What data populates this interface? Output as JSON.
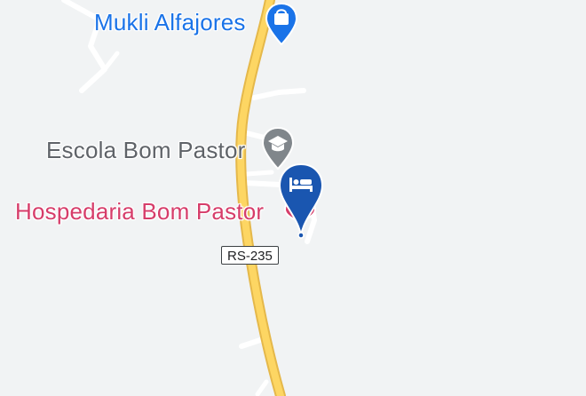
{
  "map": {
    "colors": {
      "background": "#f1f3f4",
      "highway_fill": "#fdd663",
      "highway_casing": "#e5b84a",
      "minor_road": "#ffffff",
      "shop_accent": "#1a73e8",
      "school_accent": "#80868b",
      "hotel_accent": "#d63d6a",
      "selected_pin": "#1a56b0"
    },
    "places": [
      {
        "name": "Mukli Alfajores",
        "category": "shopping",
        "icon": "shopping-bag-icon"
      },
      {
        "name": "Escola Bom Pastor",
        "category": "school",
        "icon": "graduation-cap-icon"
      },
      {
        "name": "Hospedaria Bom Pastor",
        "category": "hotel",
        "icon": "bed-icon",
        "selected": true
      }
    ],
    "road_shield": "RS-235"
  }
}
